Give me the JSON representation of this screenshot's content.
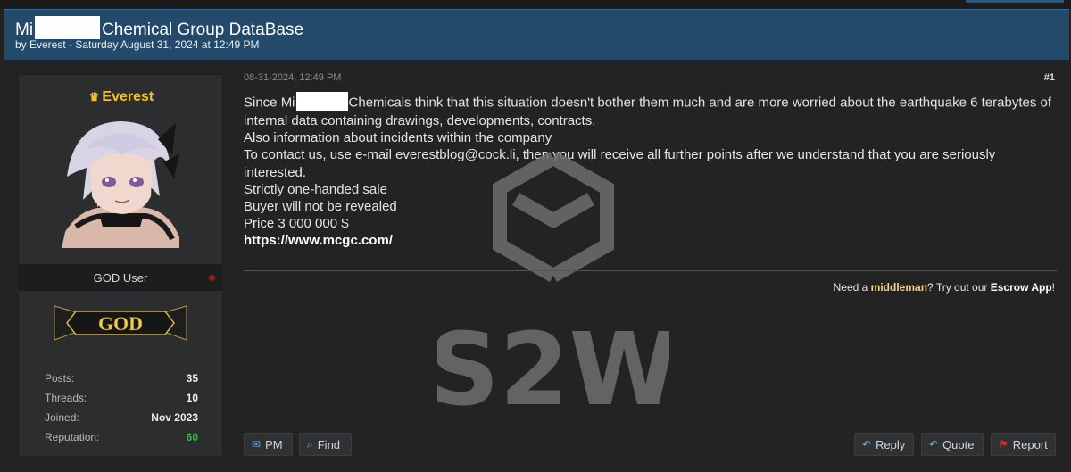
{
  "thread": {
    "title_start": "Mi",
    "title_end": "Chemical Group DataBase",
    "byline": "by Everest - Saturday August 31, 2024 at 12:49 PM"
  },
  "user": {
    "name": "Everest",
    "rank_title": "GOD User",
    "badge": "GOD",
    "stats": [
      {
        "label": "Posts:",
        "value": "35"
      },
      {
        "label": "Threads:",
        "value": "10"
      },
      {
        "label": "Joined:",
        "value": "Nov 2023"
      },
      {
        "label": "Reputation:",
        "value": "60"
      }
    ]
  },
  "post": {
    "date": "08-31-2024, 12:49 PM",
    "number": "#1",
    "line1_start": "Since Mi",
    "line1_end": "Chemicals think that this situation doesn't bother them much and are more worried about the earthquake 6 terabytes of internal data containing drawings, developments, contracts.",
    "line2": "Also information about incidents within the company",
    "line3": "To contact us, use e-mail everestblog@cock.li, then you will receive all further points after we understand that you are seriously interested.",
    "line4": "Strictly one-handed sale",
    "line5": "Buyer will not be revealed",
    "line6": "Price 3 000 000 $",
    "link": "https://www.mcgc.com/"
  },
  "escrow": {
    "prefix": "Need a",
    "link1": "middleman",
    "middle": "? Try out our",
    "link2": "Escrow App",
    "suffix": "!"
  },
  "watermark": "S2W",
  "buttons": {
    "pm": "PM",
    "find": "Find",
    "reply": "Reply",
    "quote": "Quote",
    "report": "Report"
  },
  "colors": {
    "header_bg": "#234a6b",
    "username": "#f3c02a",
    "reputation": "#39b54a"
  }
}
